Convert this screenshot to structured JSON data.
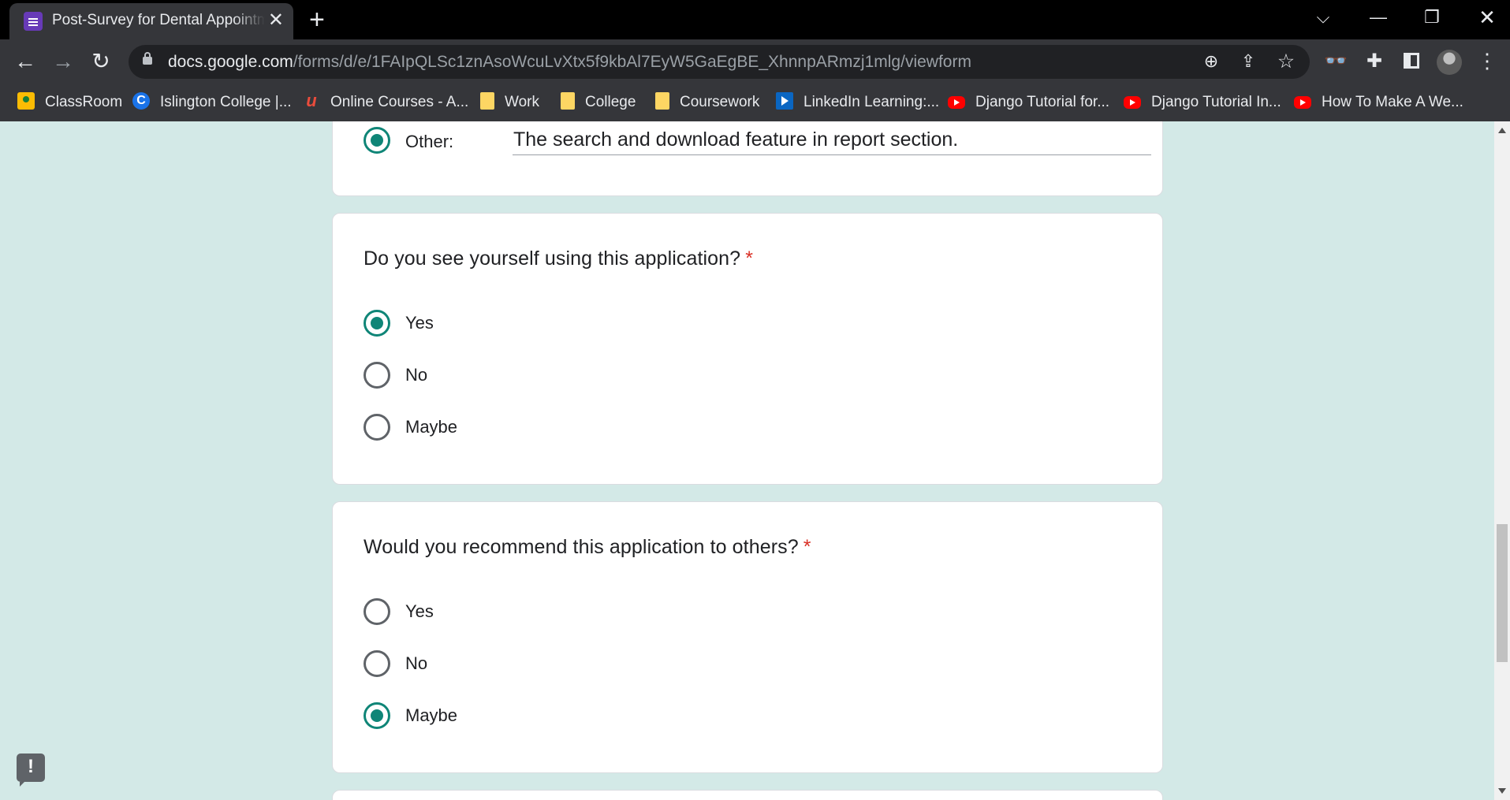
{
  "browser": {
    "tab": {
      "title": "Post-Survey for Dental Appointment",
      "favicon": "google-forms-icon"
    },
    "url_host": "docs.google.com",
    "url_path": "/forms/d/e/1FAIpQLSc1znAsoWcuLvXtx5f9kbAl7EyW5GaEgBE_XhnnpARmzj1mlg/viewform",
    "bookmarks": [
      {
        "label": "ClassRoom",
        "icon": "classroom-icon"
      },
      {
        "label": "Islington College |...",
        "icon": "c-icon"
      },
      {
        "label": "Online Courses - A...",
        "icon": "udemy-icon"
      },
      {
        "label": "Work",
        "icon": "folder-icon"
      },
      {
        "label": "College",
        "icon": "folder-icon"
      },
      {
        "label": "Coursework",
        "icon": "folder-icon"
      },
      {
        "label": "LinkedIn Learning:...",
        "icon": "linkedin-learning-icon"
      },
      {
        "label": "Django Tutorial for...",
        "icon": "youtube-icon"
      },
      {
        "label": "Django Tutorial In...",
        "icon": "youtube-icon"
      },
      {
        "label": "How To Make A We...",
        "icon": "youtube-icon"
      }
    ]
  },
  "form": {
    "other": {
      "label": "Other:",
      "value": "The search and download feature in report section.",
      "selected": true
    },
    "questions": [
      {
        "text": "Do you see yourself using this application?",
        "required_mark": "*",
        "options": [
          "Yes",
          "No",
          "Maybe"
        ],
        "selected": "Yes"
      },
      {
        "text": "Would you recommend this application to others?",
        "required_mark": "*",
        "options": [
          "Yes",
          "No",
          "Maybe"
        ],
        "selected": "Maybe"
      }
    ]
  },
  "colors": {
    "accent": "#0f8577",
    "page_bg": "#d3e9e7",
    "required": "#d93025"
  }
}
